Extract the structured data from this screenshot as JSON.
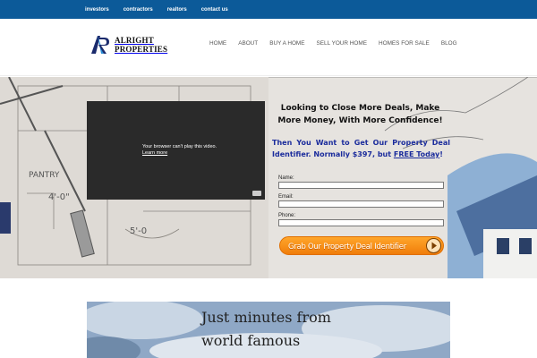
{
  "top_nav": {
    "items": [
      "investors",
      "contractors",
      "realtors",
      "contact us"
    ]
  },
  "logo": {
    "line1": "ALRIGHT",
    "line2": "PROPERTIES",
    "mark_letters": "AR"
  },
  "main_nav": {
    "items": [
      "HOME",
      "ABOUT",
      "BUY A HOME",
      "SELL YOUR HOME",
      "HOMES FOR SALE",
      "BLOG"
    ]
  },
  "hero": {
    "video": {
      "message": "Your browser can't play this video.",
      "link": "Learn more"
    },
    "headline": "Looking to Close More Deals, Make More Money, With More Confidence!",
    "subhead_main": "Then You Want to Get Our Property Deal Identifier.  Normally $397, but ",
    "subhead_free": "FREE Today",
    "subhead_end": "!",
    "form": {
      "name_label": "Name:",
      "email_label": "Email:",
      "phone_label": "Phone:"
    },
    "cta_label": "Grab Our Property Deal Identifier"
  },
  "lower": {
    "line1": "Just minutes from",
    "line2": "world famous"
  },
  "colors": {
    "top_bar": "#0c5a99",
    "subhead": "#1b2c9c",
    "cta": "#f58a12"
  }
}
